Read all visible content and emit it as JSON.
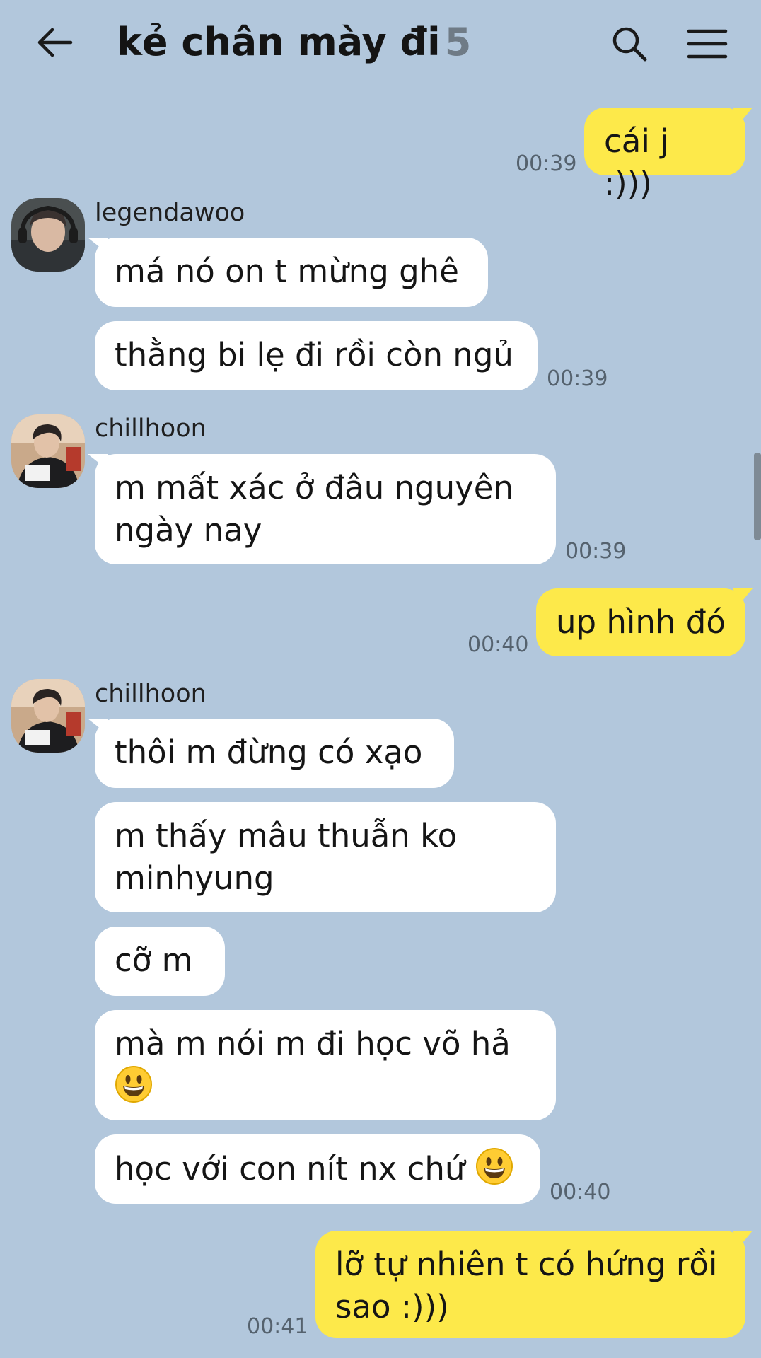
{
  "header": {
    "title": "kẻ chân mày đi",
    "member_count": "5",
    "back_icon": "arrow-left-icon",
    "search_icon": "search-icon",
    "menu_icon": "hamburger-menu-icon"
  },
  "colors": {
    "background": "#b2c7dc",
    "incoming_bubble": "#ffffff",
    "outgoing_bubble": "#fde94a",
    "timestamp": "#55626e"
  },
  "messages": {
    "m1": {
      "text": "cái j :)))",
      "time": "00:39"
    },
    "g1": {
      "sender": "legendawoo",
      "lines": [
        "má nó on t mừng ghê",
        "thằng bi lẹ đi rồi còn ngủ"
      ],
      "time": "00:39"
    },
    "g2": {
      "sender": "chillhoon",
      "lines": [
        "m mất xác ở đâu nguyên\nngày nay"
      ],
      "time": "00:39"
    },
    "m2": {
      "text": "up hình đó",
      "time": "00:40"
    },
    "g3": {
      "sender": "chillhoon",
      "lines": [
        "thôi m đừng có xạo",
        "m thấy mâu thuẫn ko\nminhyung",
        "cỡ m",
        "mà m nói m đi học võ hả",
        "học với con nít nx chứ"
      ],
      "emoji": "grinning-face-emoji",
      "time": "00:40"
    },
    "m3": {
      "text": "lỡ tự nhiên t có hứng rồi\nsao :)))",
      "time": "00:41"
    }
  }
}
